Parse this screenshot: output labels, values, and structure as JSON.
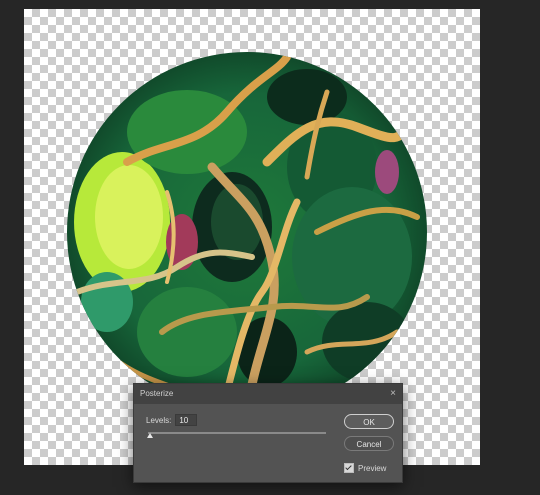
{
  "canvas": {
    "background": "#262626",
    "transparency_checker": "#cccccc",
    "artwork": "posterized-green-cell-texture-circle"
  },
  "dialog": {
    "title": "Posterize",
    "close_icon": "×",
    "levels_label": "Levels:",
    "levels_value": "10",
    "slider_level_fraction": 0.0,
    "ok_label": "OK",
    "cancel_label": "Cancel",
    "preview_label": "Preview",
    "preview_checked": true
  }
}
